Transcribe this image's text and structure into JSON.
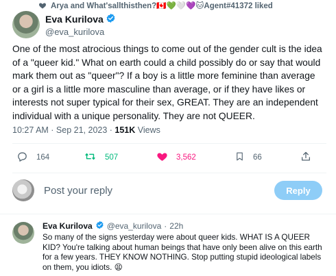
{
  "liked_bar": {
    "text": "Arya and What'sallthisthen?🇨🇦💚🤍💜🐱Agent#41372 liked",
    "icon": "heart-icon"
  },
  "tweet": {
    "author_name": "Eva Kurilova",
    "author_handle": "@eva_kurilova",
    "verified": true,
    "body": "One of the most atrocious things to come out of the gender cult is the idea of a \"queer kid.\" What on earth could a child possibly do or say that would mark them out as \"queer\"? If a boy is a little more feminine than average or a girl is a little more masculine than average, or if they have likes or interests not super typical for their sex, GREAT. They are an independent individual with a unique personality. They are not QUEER.",
    "time": "10:27 AM · Sep 21, 2023 · ",
    "views_count": "151K",
    "views_label": " Views"
  },
  "actions": {
    "replies": "164",
    "retweets": "507",
    "likes": "3,562",
    "bookmarks": "66"
  },
  "reply_box": {
    "placeholder": "Post your reply",
    "button_label": "Reply"
  },
  "reply_tweet": {
    "author_name": "Eva Kurilova",
    "author_handle": "@eva_kurilova",
    "separator": "·",
    "time": "22h",
    "body": "So many of the signs yesterday were about queer kids. WHAT IS A QUEER KID? You're talking about human beings that have only been alive on this earth for a few years. THEY KNOW NOTHING. Stop putting stupid ideological labels on them, you idiots. 😫"
  },
  "colors": {
    "accent": "#1d9bf0",
    "retweet_active": "#00ba7c",
    "like_active": "#f91880",
    "muted": "#536471",
    "reply_button_disabled": "#8ecdf7"
  }
}
